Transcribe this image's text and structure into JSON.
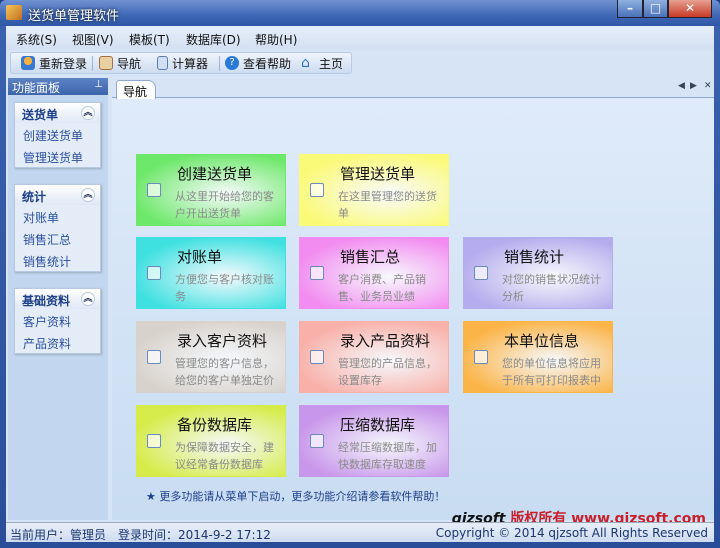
{
  "window": {
    "title": "送货单管理软件"
  },
  "menu": [
    "系统(S)",
    "视图(V)",
    "模板(T)",
    "数据库(D)",
    "帮助(H)"
  ],
  "toolbar": {
    "relogin": "重新登录",
    "nav": "导航",
    "calc": "计算器",
    "help": "查看帮助",
    "home": "主页"
  },
  "panel": {
    "title": "功能面板",
    "groups": [
      {
        "title": "送货单",
        "items": [
          "创建送货单",
          "管理送货单"
        ]
      },
      {
        "title": "统计",
        "items": [
          "对账单",
          "销售汇总",
          "销售统计"
        ]
      },
      {
        "title": "基础资料",
        "items": [
          "客户资料",
          "产品资料"
        ]
      }
    ]
  },
  "tab": {
    "label": "导航"
  },
  "cards": [
    {
      "title": "创建送货单",
      "desc": "从这里开始给您的客户开出送货单",
      "color": "#6ee86a"
    },
    {
      "title": "管理送货单",
      "desc": "在这里管理您的送货单",
      "color": "#fbfa78"
    },
    {
      "title": "对账单",
      "desc": "方便您与客户核对账务",
      "color": "#3fe0e0"
    },
    {
      "title": "销售汇总",
      "desc": "客户消费、产品销售、业务员业绩",
      "color": "#f28cf0"
    },
    {
      "title": "销售统计",
      "desc": "对您的销售状况统计分析",
      "color": "#b4acec"
    },
    {
      "title": "录入客户资料",
      "desc": "管理您的客户信息，给您的客户单独定价",
      "color": "#d8d2cc"
    },
    {
      "title": "录入产品资料",
      "desc": "管理您的产品信息，设置库存",
      "color": "#f8b0a8"
    },
    {
      "title": "本单位信息",
      "desc": "您的单位信息将应用于所有可打印报表中",
      "color": "#fbb448"
    },
    {
      "title": "备份数据库",
      "desc": "为保障数据安全，建议经常备份数据库",
      "color": "#d6ec4a"
    },
    {
      "title": "压缩数据库",
      "desc": "经常压缩数据库，加快数据库存取速度",
      "color": "#c896ea"
    }
  ],
  "note": "★ 更多功能请从菜单下启动，更多功能介绍请参看软件帮助！",
  "brand": {
    "name": "qjzsoft",
    "rights": "版权所有",
    "url": "www.qjzsoft.com"
  },
  "status": {
    "user": "当前用户：管理员",
    "login": "登录时间：2014-9-2 17:12",
    "copyright": "Copyright © 2014 qjzsoft All Rights Reserved"
  }
}
